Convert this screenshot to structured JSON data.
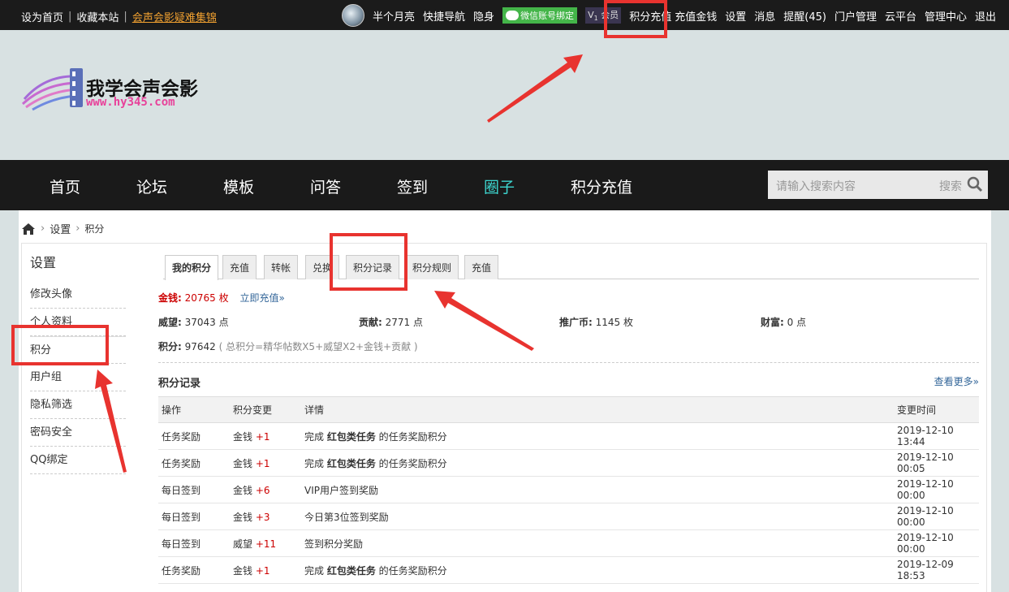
{
  "topbar": {
    "left": [
      "设为首页",
      "收藏本站",
      "会声会影疑难集锦"
    ],
    "username": "半个月亮",
    "links": [
      "快捷导航",
      "隐身",
      "微信账号绑定",
      "会员",
      "积分充值",
      "充值金钱",
      "设置",
      "消息",
      "提醒(45)",
      "门户管理",
      "云平台",
      "管理中心",
      "退出"
    ]
  },
  "logo": {
    "title": "我学会声会影",
    "url": "www.hy345.com"
  },
  "nav": {
    "items": [
      "首页",
      "论坛",
      "模板",
      "问答",
      "签到",
      "圈子",
      "积分充值"
    ],
    "active": "圈子"
  },
  "search": {
    "placeholder": "请输入搜索内容",
    "button": "搜索"
  },
  "breadcrumb": [
    "设置",
    "积分"
  ],
  "sidebar": {
    "title": "设置",
    "items": [
      "修改头像",
      "个人资料",
      "积分",
      "用户组",
      "隐私筛选",
      "密码安全",
      "QQ绑定"
    ]
  },
  "tabs": [
    "我的积分",
    "充值",
    "转帐",
    "兑换",
    "积分记录",
    "积分规则",
    "充值"
  ],
  "money": {
    "label": "金钱:",
    "value": "20765 枚",
    "link": "立即充值»"
  },
  "stats": [
    {
      "label": "威望:",
      "value": "37043 点"
    },
    {
      "label": "贡献:",
      "value": "2771 点"
    },
    {
      "label": "推广币:",
      "value": "1145 枚"
    },
    {
      "label": "财富:",
      "value": "0 点"
    }
  ],
  "total": {
    "label": "积分:",
    "value": "97642",
    "hint": "( 总积分=精华帖数X5+威望X2+金钱+贡献 )"
  },
  "records": {
    "title": "积分记录",
    "more": "查看更多»",
    "headers": [
      "操作",
      "积分变更",
      "详情",
      "变更时间"
    ],
    "rows": [
      {
        "op": "任务奖励",
        "type": "金钱",
        "delta": "+1",
        "pre": "完成 ",
        "bold": "红包类任务",
        "post": " 的任务奖励积分",
        "time": "2019-12-10 13:44"
      },
      {
        "op": "任务奖励",
        "type": "金钱",
        "delta": "+1",
        "pre": "完成 ",
        "bold": "红包类任务",
        "post": " 的任务奖励积分",
        "time": "2019-12-10 00:05"
      },
      {
        "op": "每日签到",
        "type": "金钱",
        "delta": "+6",
        "pre": "VIP用户签到奖励",
        "bold": "",
        "post": "",
        "time": "2019-12-10 00:00"
      },
      {
        "op": "每日签到",
        "type": "金钱",
        "delta": "+3",
        "pre": "今日第3位签到奖励",
        "bold": "",
        "post": "",
        "time": "2019-12-10 00:00"
      },
      {
        "op": "每日签到",
        "type": "威望",
        "delta": "+11",
        "pre": "签到积分奖励",
        "bold": "",
        "post": "",
        "time": "2019-12-10 00:00"
      },
      {
        "op": "任务奖励",
        "type": "金钱",
        "delta": "+1",
        "pre": "完成 ",
        "bold": "红包类任务",
        "post": " 的任务奖励积分",
        "time": "2019-12-09 18:53"
      }
    ]
  },
  "colors": {
    "accent": "#e8332f",
    "nav_active": "#3dd6d0",
    "money": "#cc0000",
    "link": "#336699"
  }
}
